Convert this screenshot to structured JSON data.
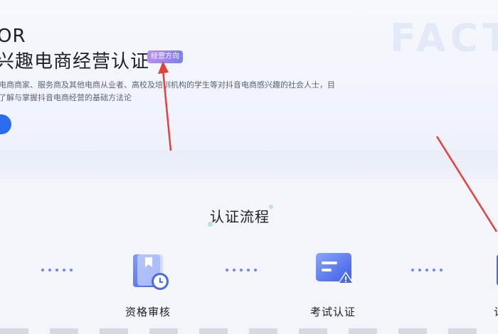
{
  "hero": {
    "watermark": "FACTO",
    "title_line1": "OR",
    "title_line2": "兴趣电商经营认证",
    "badge": "经营方向",
    "description_line1": "电商商家、服务商及其他电商从业者、高校及培训机构的学生等对抖音电商感兴趣的社会人士，目",
    "description_line2": "了解与掌握抖音电商经营的基础方法论"
  },
  "process": {
    "title": "认证流程",
    "steps": [
      {
        "label": "资格审核",
        "icon": "document-clock-icon"
      },
      {
        "label": "考试认证",
        "icon": "chat-warning-icon"
      },
      {
        "label": "认",
        "icon": "certificate-icon"
      }
    ]
  },
  "colors": {
    "accent": "#2c6df0",
    "badge_start": "#b98cf2",
    "badge_end": "#7b7ff0",
    "arrow": "#e5403a"
  }
}
